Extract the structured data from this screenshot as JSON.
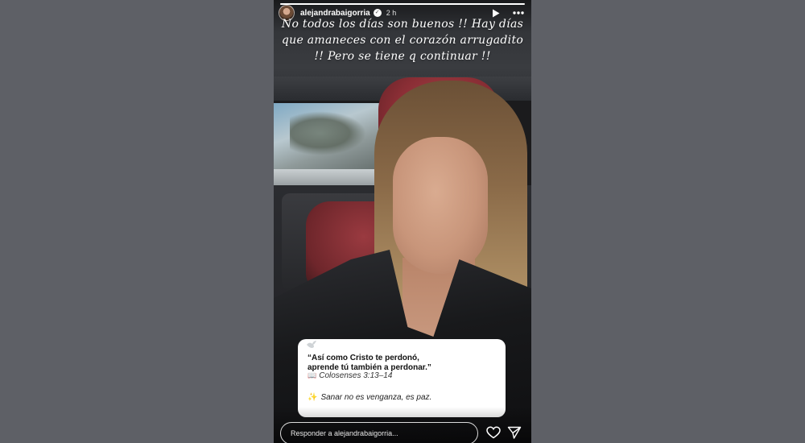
{
  "story": {
    "username": "alejandrabaigorria",
    "time_ago": "2 h",
    "progress_fraction": 1.0,
    "caption": "No todos los días son buenos !! Hay días que amaneces con el corazón arrugadito !! Pero se tiene q continuar !!",
    "icons": [
      "verified-icon",
      "play-icon",
      "more-icon",
      "dove-icon",
      "book-icon",
      "sparkle-icon",
      "heart-icon",
      "send-icon"
    ]
  },
  "quote_card": {
    "line1": "“Así como Cristo te perdonó,",
    "line2": "aprende tú también a perdonar.”",
    "book_glyph": "📖",
    "reference": "Colosenses 3:13–14",
    "sparkle_glyph": "✨",
    "message": "Sanar no es venganza, es paz."
  },
  "reply": {
    "placeholder": "Responder a alejandrabaigorria..."
  },
  "colors": {
    "page_background": "#5e6066",
    "text": "#ffffff",
    "card_background": "#ffffff"
  }
}
